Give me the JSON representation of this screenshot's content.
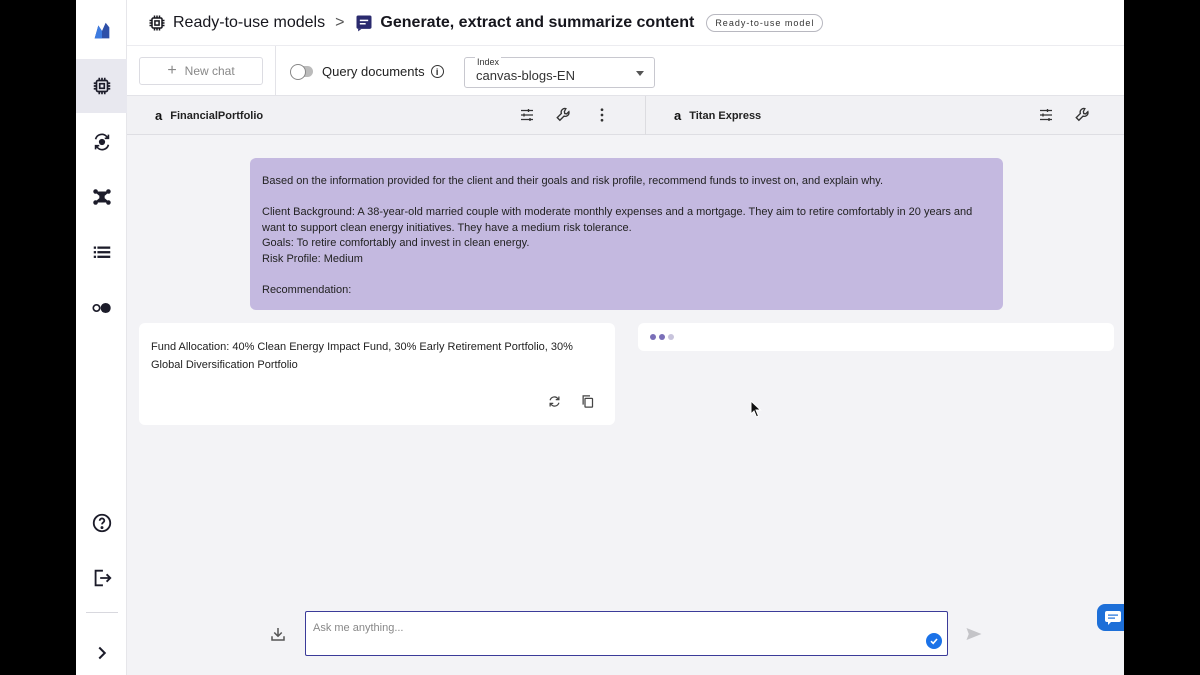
{
  "breadcrumb": {
    "parent": "Ready-to-use models",
    "separator": ">",
    "current": "Generate, extract and summarize content",
    "badge": "Ready-to-use model"
  },
  "toolbar": {
    "new_chat_label": "New chat",
    "query_documents_label": "Query documents",
    "query_documents_enabled": false,
    "index_label": "Index",
    "index_value": "canvas-blogs-EN"
  },
  "models": [
    {
      "provider_glyph": "a",
      "name": "FinancialPortfolio"
    },
    {
      "provider_glyph": "a",
      "name": "Titan Express"
    }
  ],
  "prompt": {
    "lines": [
      "Based on the information provided for the client and their goals and risk profile, recommend funds to invest on, and explain why.",
      "Client Background: A 38-year-old married couple with moderate monthly expenses and a mortgage. They aim to retire comfortably in 20 years and want to support clean energy initiatives. They have a medium risk tolerance.",
      "Goals: To retire comfortably and invest in clean energy.",
      "Risk Profile: Medium",
      "Recommendation:"
    ]
  },
  "responses": [
    {
      "text": "Fund Allocation: 40% Clean Energy Impact Fund, 30% Early Retirement Portfolio, 30% Global Diversification Portfolio",
      "loading": false
    },
    {
      "text": "",
      "loading": true
    }
  ],
  "input": {
    "placeholder": "Ask me anything..."
  },
  "icons": {
    "sidebar": [
      "canvas-logo-icon",
      "chip-icon",
      "refresh-bulb-icon",
      "nodes-icon",
      "list-icon",
      "toggle-dots-icon",
      "help-icon",
      "logout-icon",
      "expand-icon"
    ]
  },
  "colors": {
    "prompt_bubble": "#c4b9e0",
    "input_border": "#3b3b99",
    "accent_blue": "#1b72e8"
  }
}
